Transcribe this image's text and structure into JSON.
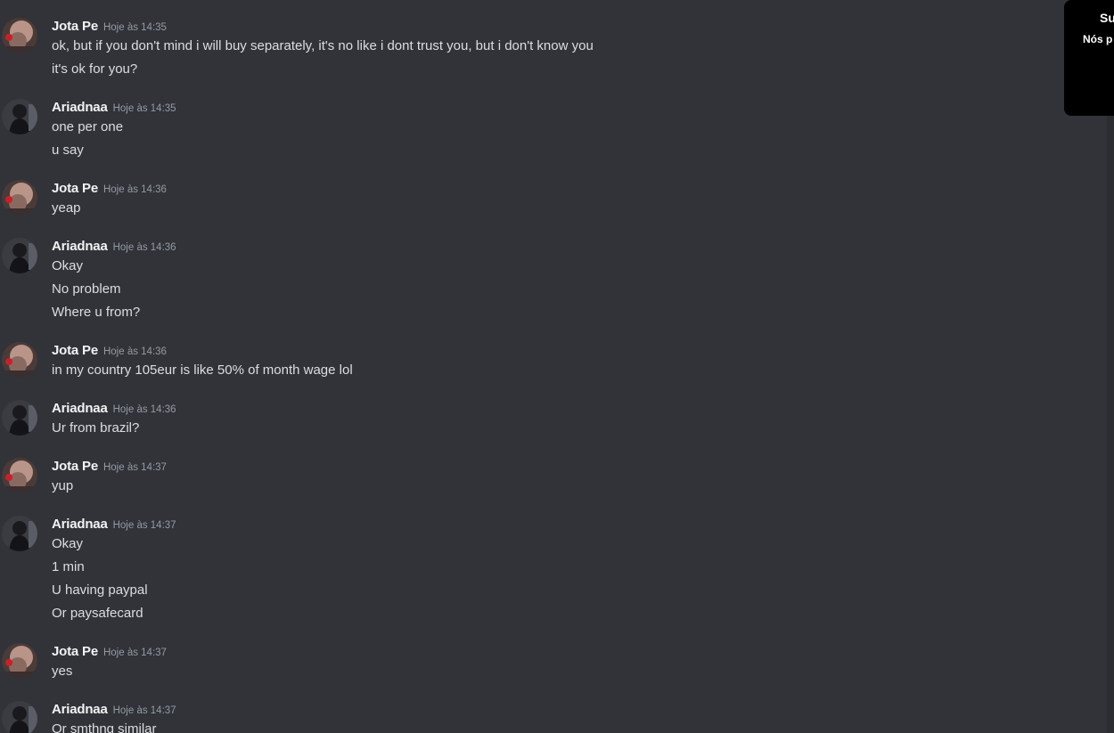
{
  "chat": {
    "groups": [
      {
        "author": "Jota Pe",
        "avatar": "jota-avatar",
        "timestamp": "Hoje às 14:35",
        "lines": [
          "ok, but if you don't mind i will buy separately, it's no like i dont trust you, but i don't know you",
          "it's ok for you?"
        ]
      },
      {
        "author": "Ariadnaa",
        "avatar": "ariadnaa-avatar",
        "timestamp": "Hoje às 14:35",
        "lines": [
          "one per one",
          "u say"
        ]
      },
      {
        "author": "Jota Pe",
        "avatar": "jota-avatar",
        "timestamp": "Hoje às 14:36",
        "lines": [
          "yeap"
        ]
      },
      {
        "author": "Ariadnaa",
        "avatar": "ariadnaa-avatar",
        "timestamp": "Hoje às 14:36",
        "lines": [
          "Okay",
          "No problem",
          "Where u from?"
        ]
      },
      {
        "author": "Jota Pe",
        "avatar": "jota-avatar",
        "timestamp": "Hoje às 14:36",
        "lines": [
          "in my country 105eur is like 50% of month wage lol"
        ]
      },
      {
        "author": "Ariadnaa",
        "avatar": "ariadnaa-avatar",
        "timestamp": "Hoje às 14:36",
        "lines": [
          "Ur from brazil?"
        ]
      },
      {
        "author": "Jota Pe",
        "avatar": "jota-avatar",
        "timestamp": "Hoje às 14:37",
        "lines": [
          "yup"
        ]
      },
      {
        "author": "Ariadnaa",
        "avatar": "ariadnaa-avatar",
        "timestamp": "Hoje às 14:37",
        "lines": [
          "Okay",
          "1 min",
          "U having paypal",
          "Or paysafecard"
        ]
      },
      {
        "author": "Jota Pe",
        "avatar": "jota-avatar",
        "timestamp": "Hoje às 14:37",
        "lines": [
          "yes"
        ]
      },
      {
        "author": "Ariadnaa",
        "avatar": "ariadnaa-avatar",
        "timestamp": "Hoje às 14:37",
        "lines": [
          "Or smthng similar"
        ]
      }
    ]
  },
  "popup": {
    "title": "Su",
    "text": "Nós p"
  },
  "colors": {
    "background": "#313338",
    "username": "#f2f3f5",
    "message_text": "#dbdee1",
    "timestamp": "#949ba4",
    "popup_background": "#000000"
  }
}
